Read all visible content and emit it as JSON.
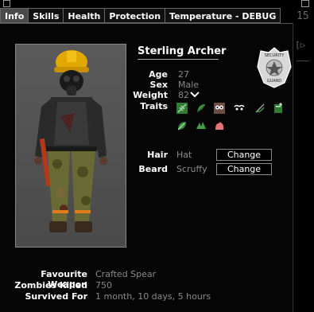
{
  "window": {
    "close_icon": "close-box-icon",
    "pin_icon": "pin-box-icon"
  },
  "tabs": [
    {
      "label": "Info",
      "active": true
    },
    {
      "label": "Skills",
      "active": false
    },
    {
      "label": "Health",
      "active": false
    },
    {
      "label": "Protection",
      "active": false
    },
    {
      "label": "Temperature - DEBUG",
      "active": false
    }
  ],
  "background_fragments": {
    "top_right": "15",
    "mid_right": "[▷"
  },
  "character": {
    "name": "Sterling Archer",
    "age_label": "Age",
    "age": "27",
    "sex_label": "Sex",
    "sex": "Male",
    "weight_label": "Weight",
    "weight": "82",
    "weight_trend_icon": "chevron-down-icon",
    "traits_label": "Traits",
    "traits": [
      "leaf-trait-icon",
      "feather-trait-icon",
      "owl-trait-icon",
      "eyes-trait-icon",
      "needle-trait-icon",
      "book-trait-icon",
      "leaf2-trait-icon",
      "grass-trait-icon",
      "muscle-trait-icon"
    ],
    "profession_badge": "security-guard-badge",
    "badge_top_text": "SECURITY",
    "badge_bottom_text": "GUARD"
  },
  "appearance": {
    "hair_label": "Hair",
    "hair_value": "Hat",
    "beard_label": "Beard",
    "beard_value": "Scruffy",
    "change_label": "Change"
  },
  "stats": {
    "favourite_weapon_label": "Favourite Weapon",
    "favourite_weapon": "Crafted Spear",
    "zombies_killed_label": "Zombies Killed",
    "zombies_killed": "750",
    "survived_for_label": "Survived For",
    "survived_for": "1 month, 10 days, 5 hours"
  },
  "colors": {
    "tab_active": "#4a4a4a",
    "value_text": "#8a8a8a",
    "panel_bg": "#050505"
  }
}
